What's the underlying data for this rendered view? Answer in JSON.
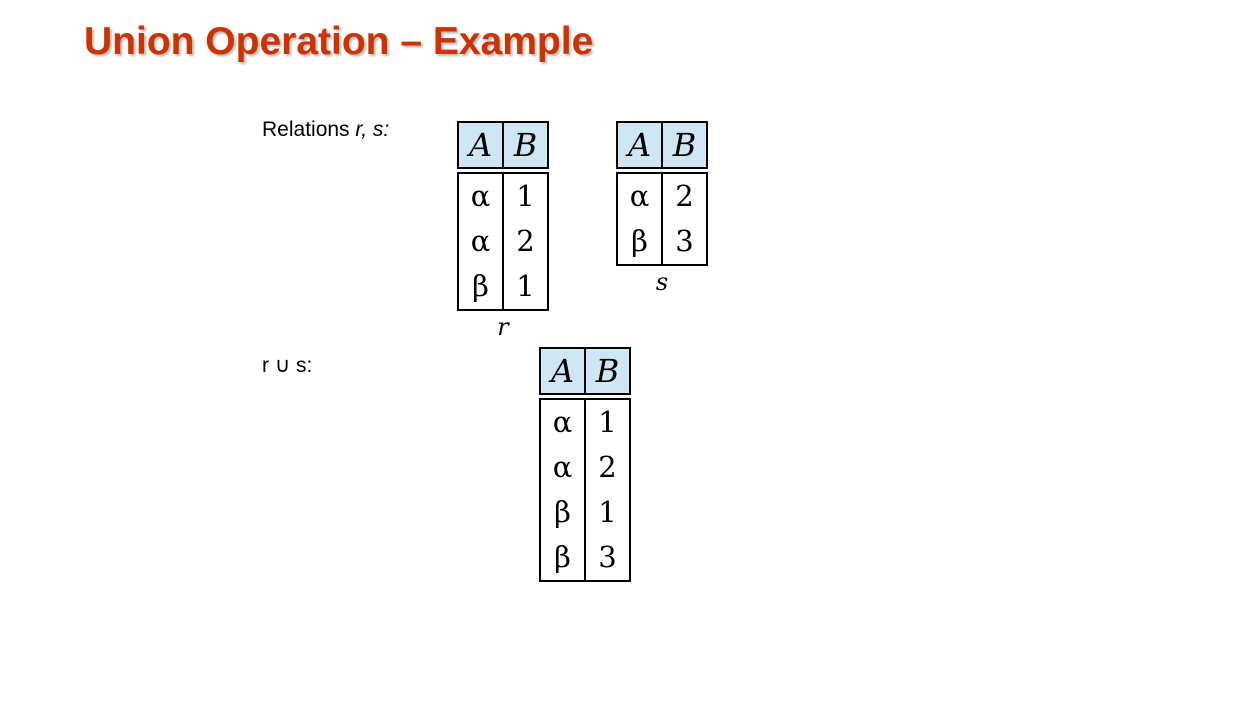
{
  "title": "Union Operation – Example",
  "relations_label": {
    "prefix": "Relations ",
    "names": "r, s:"
  },
  "union_label": "r ∪ s:",
  "relations": {
    "r": {
      "caption": "r",
      "headers": [
        "A",
        "B"
      ],
      "rows": [
        [
          "α",
          "1"
        ],
        [
          "α",
          "2"
        ],
        [
          "β",
          "1"
        ]
      ]
    },
    "s": {
      "caption": "s",
      "headers": [
        "A",
        "B"
      ],
      "rows": [
        [
          "α",
          "2"
        ],
        [
          "β",
          "3"
        ]
      ]
    },
    "union": {
      "headers": [
        "A",
        "B"
      ],
      "rows": [
        [
          "α",
          "1"
        ],
        [
          "α",
          "2"
        ],
        [
          "β",
          "1"
        ],
        [
          "β",
          "3"
        ]
      ]
    }
  },
  "colors": {
    "title": "#cc3300",
    "header_bg": "#cfe7f5"
  }
}
